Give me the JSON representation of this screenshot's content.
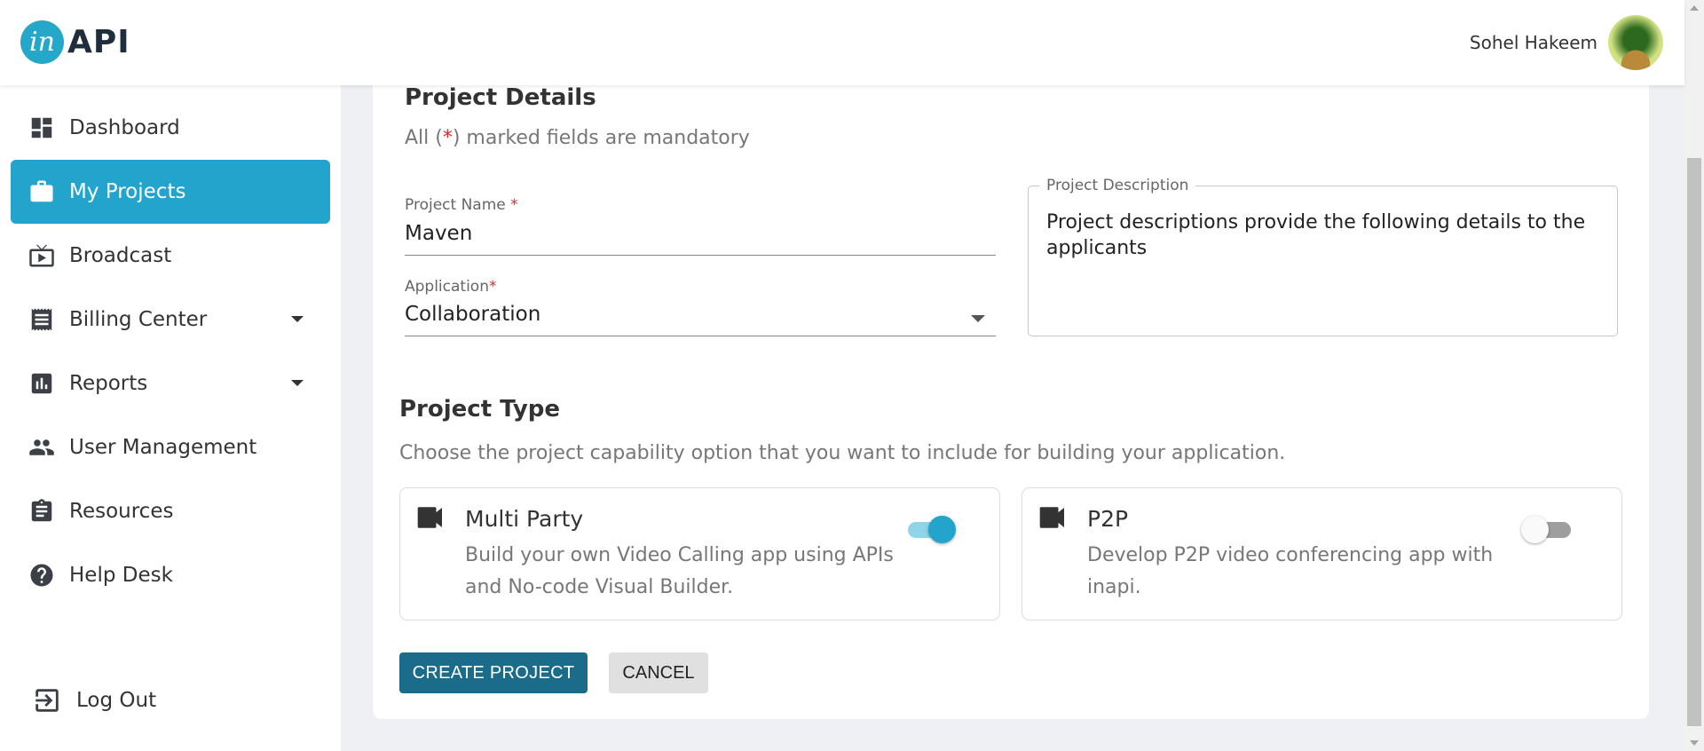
{
  "brand": {
    "logo_letter": "in",
    "logo_text": "API"
  },
  "user": {
    "name": "Sohel Hakeem"
  },
  "sidebar": {
    "items": [
      {
        "label": "Dashboard",
        "icon": "dashboard-icon",
        "active": false
      },
      {
        "label": "My Projects",
        "icon": "briefcase-icon",
        "active": true
      },
      {
        "label": "Broadcast",
        "icon": "broadcast-tv-icon",
        "active": false
      },
      {
        "label": "Billing Center",
        "icon": "receipt-icon",
        "active": false,
        "expandable": true
      },
      {
        "label": "Reports",
        "icon": "bar-chart-icon",
        "active": false,
        "expandable": true
      },
      {
        "label": "User Management",
        "icon": "people-icon",
        "active": false
      },
      {
        "label": "Resources",
        "icon": "clipboard-icon",
        "active": false
      },
      {
        "label": "Help Desk",
        "icon": "help-icon",
        "active": false
      }
    ],
    "logout_label": "Log Out"
  },
  "project_details": {
    "title": "Project Details",
    "mandatory_prefix": "All (",
    "mandatory_star": "*",
    "mandatory_suffix": ") marked fields are mandatory",
    "name_label": "Project Name",
    "name_value": "Maven",
    "application_label": "Application",
    "application_value": "Collaboration",
    "required_mark": "*",
    "description_label": "Project Description",
    "description_value": "Project descriptions provide the following details to the applicants"
  },
  "project_type": {
    "title": "Project Type",
    "subtitle": "Choose the project capability option that you want to include for building your application.",
    "options": [
      {
        "title": "Multi Party",
        "description": "Build your own Video Calling app using APIs and No-code Visual Builder.",
        "enabled": true,
        "icon": "videocam-icon"
      },
      {
        "title": "P2P",
        "description": "Develop P2P video conferencing app with inapi.",
        "enabled": false,
        "icon": "videocam-icon"
      }
    ]
  },
  "actions": {
    "create_label": "CREATE PROJECT",
    "cancel_label": "CANCEL"
  },
  "colors": {
    "accent": "#23a4cc",
    "primary_button": "#1b6c8a",
    "required": "#d32f2f"
  }
}
